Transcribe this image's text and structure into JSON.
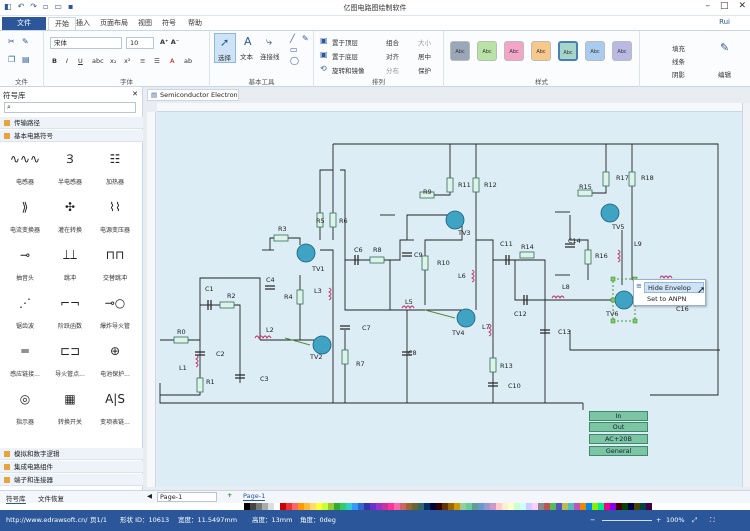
{
  "app": {
    "title": "亿图电路图绘制软件"
  },
  "ribbon_tabs": [
    "文件",
    "开始",
    "插入",
    "页面布局",
    "视图",
    "符号",
    "帮助"
  ],
  "ribbon": {
    "font_name": "宋体",
    "font_size": "10",
    "select_label": "选择",
    "text_label": "文本",
    "connector_label": "连接线",
    "bring_front": "置于顶层",
    "send_back": "置于底层",
    "rotate_mirror": "旋转和镜像",
    "group": "组合",
    "align": "对齐",
    "distribute": "分布",
    "size": "大小",
    "center": "居中",
    "protect": "保护",
    "fill": "填充",
    "line": "线条",
    "shadow": "阴影",
    "edit": "编辑",
    "style_label": "Abc",
    "groups": {
      "file": "文件",
      "font": "字体",
      "basic_tools": "基本工具",
      "arrange": "排列",
      "styles": "样式"
    },
    "user": "Rui"
  },
  "symbol_library": {
    "title": "符号库",
    "categories_top": [
      "传输路径",
      "基本电路符号"
    ],
    "items": [
      {
        "label": "电感器"
      },
      {
        "label": "半电感器"
      },
      {
        "label": "加热器"
      },
      {
        "label": "电流变换器"
      },
      {
        "label": "灌在转换"
      },
      {
        "label": "电源变压器"
      },
      {
        "label": "抽音头"
      },
      {
        "label": "跳冲"
      },
      {
        "label": "交替跳冲"
      },
      {
        "label": "锯齿波"
      },
      {
        "label": "阶跃函数"
      },
      {
        "label": "爆炸导火管"
      },
      {
        "label": "感应链接..."
      },
      {
        "label": "导火管点..."
      },
      {
        "label": "电池保护..."
      },
      {
        "label": "指示器"
      },
      {
        "label": "转换开关"
      },
      {
        "label": "变项表链..."
      }
    ],
    "categories_bottom": [
      "模拟和数字逻辑",
      "集成电路组件",
      "端子和连接器"
    ],
    "tabs": [
      "符号库",
      "文件恢复"
    ]
  },
  "document": {
    "tab": "Semiconductor Electron"
  },
  "diagram": {
    "labels": [
      "R0",
      "C1",
      "R2",
      "C2",
      "L1",
      "R1",
      "L2",
      "C3",
      "R3",
      "C4",
      "R4",
      "TV1",
      "TV2",
      "R5",
      "R6",
      "L3",
      "C6",
      "R8",
      "C9",
      "C7",
      "R7",
      "C8",
      "L5",
      "R9",
      "R11",
      "R12",
      "TV3",
      "R10",
      "L6",
      "TV4",
      "L7",
      "R13",
      "C10",
      "C11",
      "R14",
      "C12",
      "C13",
      "L8",
      "C14",
      "R16",
      "R15",
      "R17",
      "R18",
      "TV5",
      "L9",
      "TV6",
      "C16"
    ],
    "box_rows": [
      "In",
      "Out",
      "AC+20B",
      "General"
    ]
  },
  "context_menu": {
    "items": [
      "Hide Envelop",
      "Set to ANPN"
    ]
  },
  "pages": {
    "tab": "Page-1",
    "active": "Page-1"
  },
  "status": {
    "url": "http://www.edrawsoft.cn/",
    "page": "页1/1",
    "shape_id": "形状 ID：10613",
    "width": "宽度：11.5497mm",
    "height": "高度：13mm",
    "angle": "角度：0deg",
    "zoom": "100%"
  }
}
